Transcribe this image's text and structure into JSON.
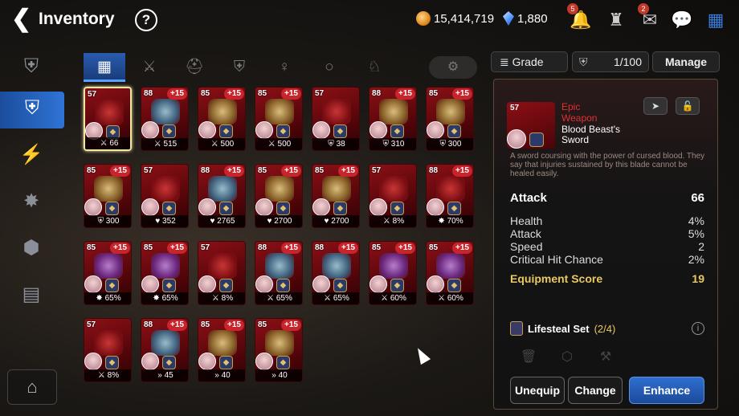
{
  "header": {
    "back_icon": "back-arrow-icon",
    "title": "Inventory",
    "help_icon": "help-icon",
    "help_symbol": "?",
    "gold": "15,414,719",
    "crystals": "1,880",
    "notifications_badge": "5",
    "mail_badge": "2"
  },
  "sidebar": {
    "items": [
      "equipment-tab-icon",
      "equipment-unequipped-icon",
      "artifact-icon",
      "catalyst-icon",
      "material-icon",
      "chest-icon"
    ],
    "bottom": "storage-icon"
  },
  "tabs": {
    "items": [
      "all-grid-icon",
      "weapon-icon",
      "helmet-icon",
      "armor-icon",
      "necklace-icon",
      "ring-icon",
      "boots-icon"
    ],
    "filter": "filter-icon"
  },
  "toolbar": {
    "grade_label": "Grade",
    "capacity": "1/100",
    "manage_label": "Manage"
  },
  "items": [
    {
      "level": "57",
      "plus": "",
      "stat": "66",
      "statIcon": "⚔",
      "art": "red",
      "sel": true
    },
    {
      "level": "88",
      "plus": "+15",
      "stat": "515",
      "statIcon": "⚔",
      "art": "blue"
    },
    {
      "level": "85",
      "plus": "+15",
      "stat": "500",
      "statIcon": "⚔",
      "art": "gold"
    },
    {
      "level": "85",
      "plus": "+15",
      "stat": "500",
      "statIcon": "⚔",
      "art": "gold"
    },
    {
      "level": "57",
      "plus": "",
      "stat": "38",
      "statIcon": "⛨",
      "art": "red"
    },
    {
      "level": "88",
      "plus": "+15",
      "stat": "310",
      "statIcon": "⛨",
      "art": "gold"
    },
    {
      "level": "85",
      "plus": "+15",
      "stat": "300",
      "statIcon": "⛨",
      "art": "gold"
    },
    {
      "level": "85",
      "plus": "+15",
      "stat": "300",
      "statIcon": "⛨",
      "art": "gold"
    },
    {
      "level": "57",
      "plus": "",
      "stat": "352",
      "statIcon": "♥",
      "art": "red"
    },
    {
      "level": "88",
      "plus": "+15",
      "stat": "2765",
      "statIcon": "♥",
      "art": "blue"
    },
    {
      "level": "85",
      "plus": "+15",
      "stat": "2700",
      "statIcon": "♥",
      "art": "gold"
    },
    {
      "level": "85",
      "plus": "+15",
      "stat": "2700",
      "statIcon": "♥",
      "art": "gold"
    },
    {
      "level": "57",
      "plus": "",
      "stat": "8%",
      "statIcon": "⚔",
      "art": "red"
    },
    {
      "level": "88",
      "plus": "+15",
      "stat": "70%",
      "statIcon": "✸",
      "art": "red"
    },
    {
      "level": "85",
      "plus": "+15",
      "stat": "65%",
      "statIcon": "✸",
      "art": "purple"
    },
    {
      "level": "85",
      "plus": "+15",
      "stat": "65%",
      "statIcon": "✸",
      "art": "purple"
    },
    {
      "level": "57",
      "plus": "",
      "stat": "8%",
      "statIcon": "⚔",
      "art": "red"
    },
    {
      "level": "88",
      "plus": "+15",
      "stat": "65%",
      "statIcon": "⚔",
      "art": "blue"
    },
    {
      "level": "88",
      "plus": "+15",
      "stat": "65%",
      "statIcon": "⚔",
      "art": "blue"
    },
    {
      "level": "85",
      "plus": "+15",
      "stat": "60%",
      "statIcon": "⚔",
      "art": "purple"
    },
    {
      "level": "85",
      "plus": "+15",
      "stat": "60%",
      "statIcon": "⚔",
      "art": "purple"
    },
    {
      "level": "57",
      "plus": "",
      "stat": "8%",
      "statIcon": "⚔",
      "art": "red"
    },
    {
      "level": "88",
      "plus": "+15",
      "stat": "45",
      "statIcon": "»",
      "art": "blue"
    },
    {
      "level": "85",
      "plus": "+15",
      "stat": "40",
      "statIcon": "»",
      "art": "gold"
    },
    {
      "level": "85",
      "plus": "+15",
      "stat": "40",
      "statIcon": "»",
      "art": "gold"
    }
  ],
  "detail": {
    "level": "57",
    "grade": "Epic",
    "type": "Weapon",
    "name": "Blood Beast's Sword",
    "description": "A sword coursing with the power of cursed blood. They say that injuries sustained by this blade cannot be healed easily.",
    "main_stat": {
      "label": "Attack",
      "value": "66"
    },
    "sub_stats": [
      {
        "label": "Health",
        "value": "4%"
      },
      {
        "label": "Attack",
        "value": "5%"
      },
      {
        "label": "Speed",
        "value": "2"
      },
      {
        "label": "Critical Hit Chance",
        "value": "2%"
      }
    ],
    "score": {
      "label": "Equipment Score",
      "value": "19"
    },
    "set": {
      "name": "Lifesteal Set",
      "count": "(2/4)"
    },
    "buttons": {
      "unequip": "Unequip",
      "change": "Change",
      "enhance": "Enhance"
    }
  },
  "colors": {
    "accent": "#2f6fd0",
    "epic": "#e03030",
    "score": "#e8c862"
  }
}
